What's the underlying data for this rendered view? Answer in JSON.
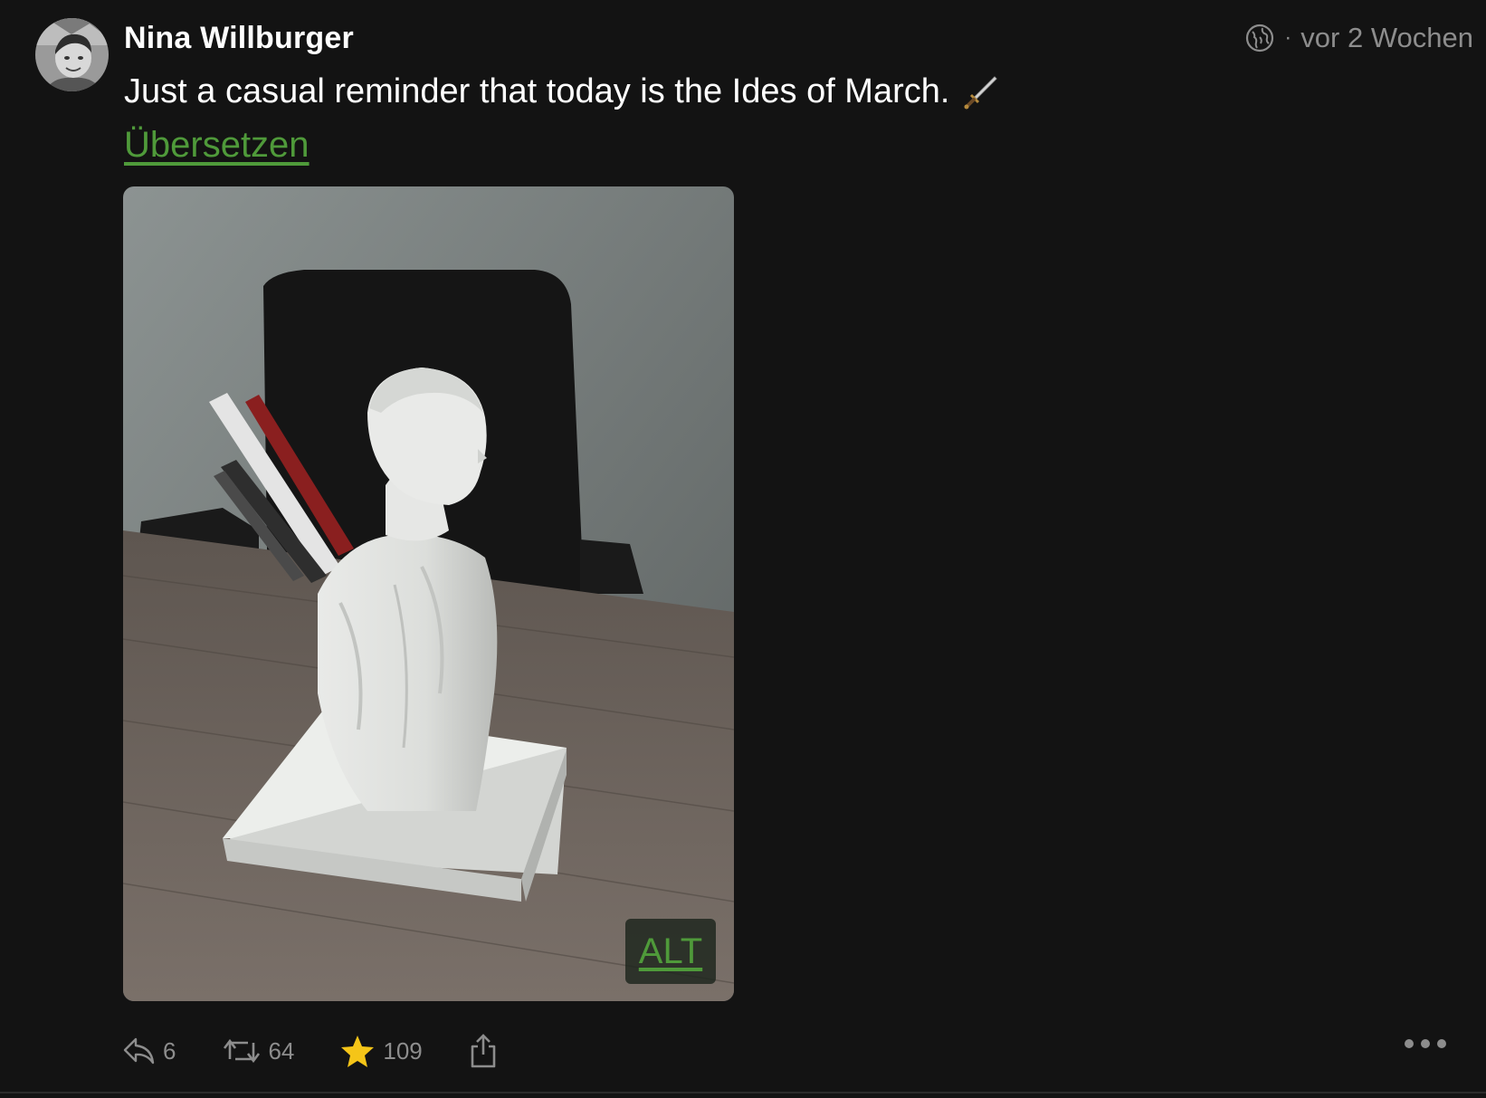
{
  "author": {
    "name": "Nina Willburger"
  },
  "meta": {
    "visibility_icon": "globe-icon",
    "separator": "·",
    "timestamp": "vor 2 Wochen"
  },
  "post": {
    "text": "Just a casual reminder that today is the Ides of March.",
    "emoji": "dagger-icon",
    "translate_label": "Übersetzen"
  },
  "media": {
    "alt_label": "ALT"
  },
  "actions": {
    "reply_count": "6",
    "boost_count": "64",
    "favourite_count": "109"
  },
  "colors": {
    "background": "#131313",
    "link_green": "#4f9a3a",
    "muted_grey": "#8d8d8d",
    "star_yellow": "#f5c518"
  }
}
